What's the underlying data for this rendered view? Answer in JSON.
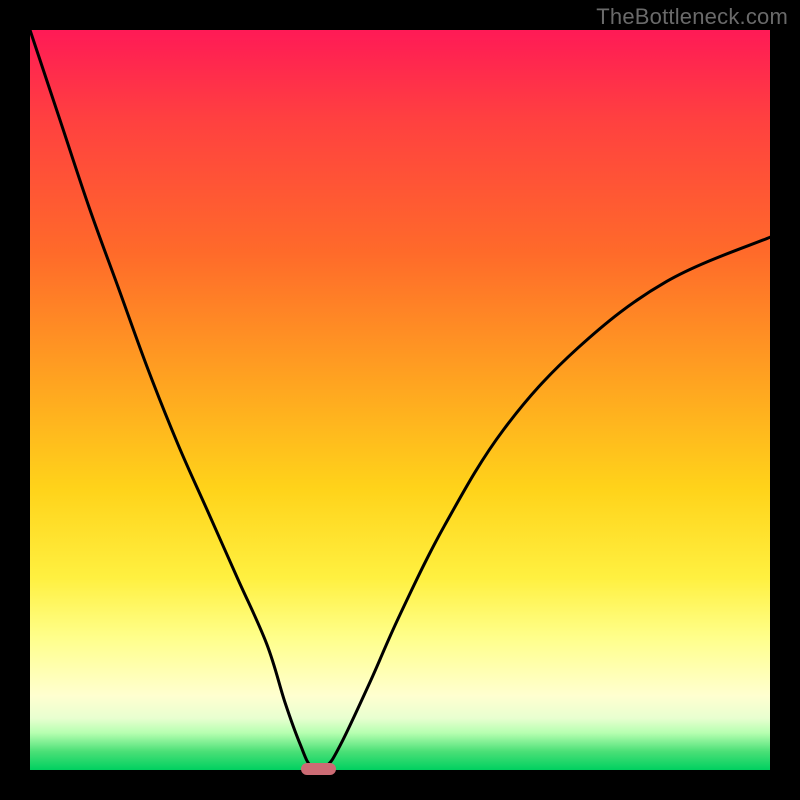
{
  "watermark": "TheBottleneck.com",
  "chart_data": {
    "type": "line",
    "title": "",
    "xlabel": "",
    "ylabel": "",
    "xlim": [
      0,
      1
    ],
    "ylim": [
      0,
      1
    ],
    "series": [
      {
        "name": "curve",
        "x": [
          0.0,
          0.04,
          0.08,
          0.12,
          0.16,
          0.2,
          0.24,
          0.28,
          0.32,
          0.345,
          0.365,
          0.38,
          0.4,
          0.42,
          0.46,
          0.5,
          0.56,
          0.64,
          0.74,
          0.86,
          1.0
        ],
        "y": [
          1.0,
          0.88,
          0.76,
          0.65,
          0.54,
          0.44,
          0.35,
          0.26,
          0.17,
          0.09,
          0.035,
          0.005,
          0.005,
          0.035,
          0.12,
          0.21,
          0.33,
          0.46,
          0.57,
          0.66,
          0.72
        ]
      }
    ],
    "marker": {
      "x": 0.39,
      "y": 0.002,
      "width_frac": 0.048
    },
    "background_gradient": {
      "top": "#ff1a56",
      "mid": "#ffd31a",
      "bottom": "#00d060"
    }
  }
}
